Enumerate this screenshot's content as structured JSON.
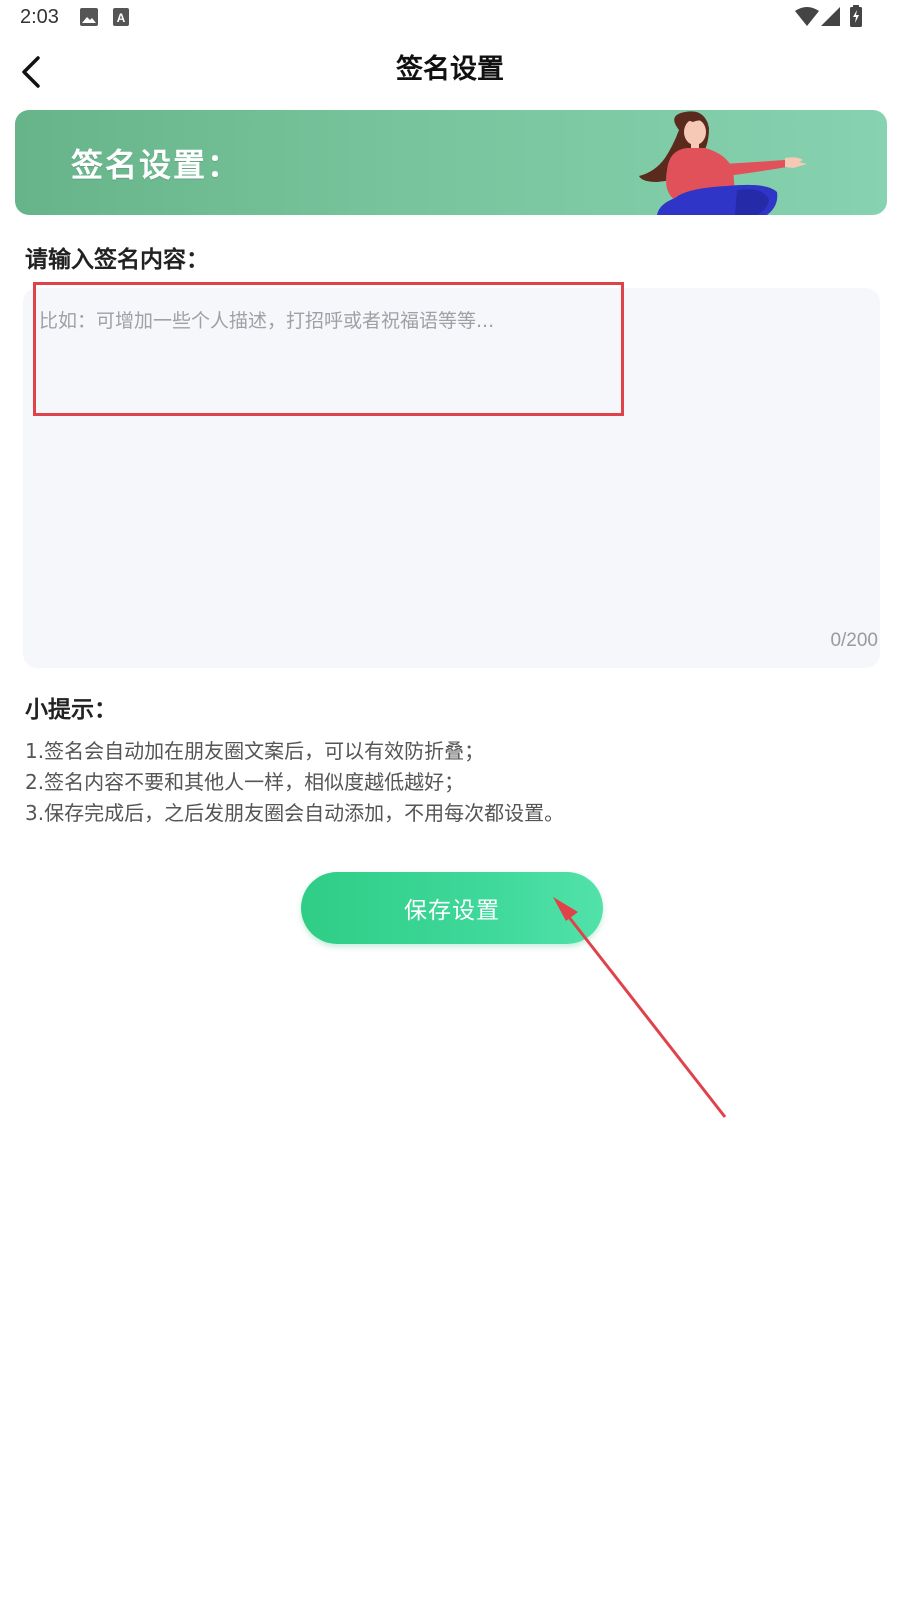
{
  "status_bar": {
    "time": "2:03",
    "icons": [
      "image-icon",
      "a-icon",
      "wifi-icon",
      "signal-icon",
      "battery-icon"
    ]
  },
  "nav": {
    "back_icon": "chevron-left-icon",
    "title": "签名设置"
  },
  "banner": {
    "title": "签名设置：",
    "illustration": "woman-sitting-illustration"
  },
  "signature": {
    "label": "请输入签名内容：",
    "placeholder": "比如：可增加一些个人描述，打招呼或者祝福语等等...",
    "value": "",
    "counter": "0/200"
  },
  "tips": {
    "title": "小提示：",
    "items": [
      "1.签名会自动加在朋友圈文案后，可以有效防折叠；",
      "2.签名内容不要和其他人一样，相似度越低越好；",
      "3.保存完成后，之后发朋友圈会自动添加，不用每次都设置。"
    ]
  },
  "save_button": {
    "label": "保存设置"
  },
  "colors": {
    "accent": "#3ed89a",
    "banner": "#78c49c",
    "annotation": "#e0424a"
  }
}
